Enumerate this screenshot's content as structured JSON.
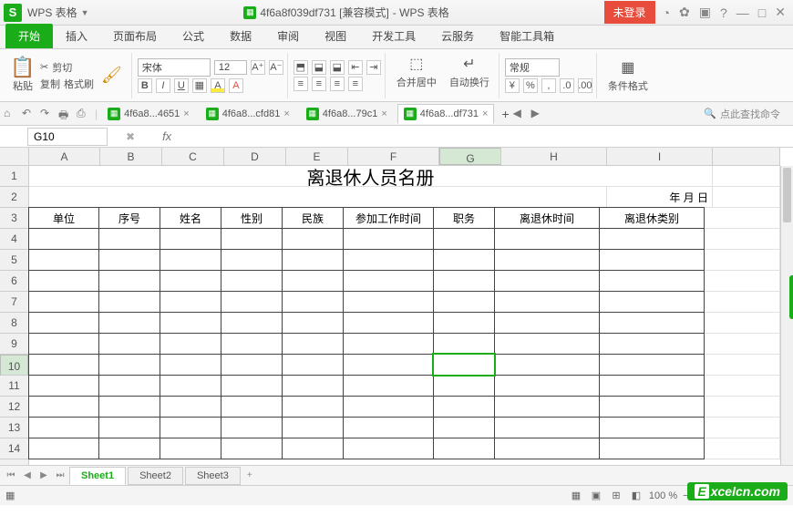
{
  "app": {
    "name": "WPS 表格",
    "logo": "S"
  },
  "title": {
    "doc": "4f6a8f039df731 [兼容模式]",
    "suffix": "- WPS 表格"
  },
  "login_badge": "未登录",
  "window_icons": {
    "q": "?",
    "min": "—",
    "max": "□",
    "close": "✕"
  },
  "cloud_icons": [
    "◔",
    "✿",
    "▣"
  ],
  "menu": {
    "tabs": [
      "开始",
      "插入",
      "页面布局",
      "公式",
      "数据",
      "审阅",
      "视图",
      "开发工具",
      "云服务",
      "智能工具箱"
    ],
    "active": 0
  },
  "ribbon": {
    "paste": "粘贴",
    "cut": "剪切",
    "copy": "复制",
    "format_painter": "格式刷",
    "font_name": "宋体",
    "font_size": "12",
    "bold": "B",
    "italic": "I",
    "underline": "U",
    "merge_center": "合并居中",
    "wrap_text": "自动换行",
    "number_format": "常规",
    "cond_format": "条件格式",
    "percent": "%"
  },
  "quick_access": [
    "↶",
    "↷",
    "🖶",
    "⎙"
  ],
  "doc_tabs": [
    {
      "label": "4f6a8...4651",
      "active": false
    },
    {
      "label": "4f6a8...cfd81",
      "active": false
    },
    {
      "label": "4f6a8...79c1",
      "active": false
    },
    {
      "label": "4f6a8...df731",
      "active": true
    }
  ],
  "doc_nav": {
    "left": "◀",
    "right": "▶"
  },
  "search_hint": "点此查找命令",
  "name_box": "G10",
  "fx": "fx",
  "columns": [
    "A",
    "B",
    "C",
    "D",
    "E",
    "F",
    "G",
    "H",
    "I"
  ],
  "rows": [
    "1",
    "2",
    "3",
    "4",
    "5",
    "6",
    "7",
    "8",
    "9",
    "10",
    "11",
    "12",
    "13",
    "14"
  ],
  "active_cell": {
    "row": 10,
    "col": "G"
  },
  "sheet_title": "离退休人员名册",
  "date_label": "年   月   日",
  "headers": [
    "单位",
    "序号",
    "姓名",
    "性别",
    "民族",
    "参加工作时间",
    "职务",
    "离退休时间",
    "离退休类别"
  ],
  "sheets": [
    "Sheet1",
    "Sheet2",
    "Sheet3"
  ],
  "active_sheet": 0,
  "status": {
    "zoom": "100 %",
    "plus": "+"
  },
  "watermark": {
    "e": "E",
    "text": "xcelcn.com"
  }
}
